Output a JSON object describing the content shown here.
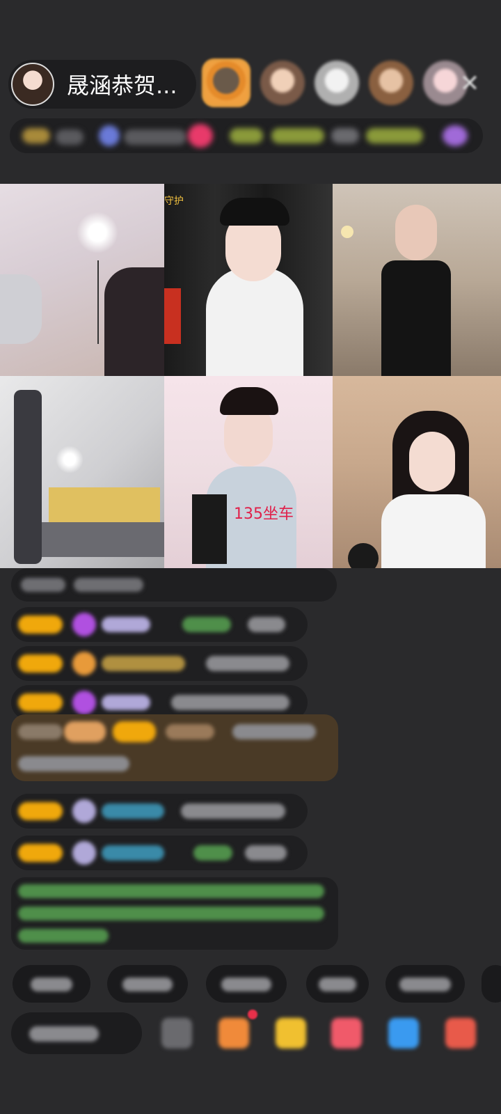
{
  "header": {
    "host_name": "晟涵恭贺...",
    "close_icon": "close-icon",
    "viewer_avatars": [
      "viewer-avatar-1",
      "viewer-avatar-2",
      "viewer-avatar-3",
      "viewer-avatar-4",
      "viewer-avatar-5"
    ]
  },
  "video_grid": {
    "tiles": [
      {
        "name": "streamer-tile-1"
      },
      {
        "name": "streamer-tile-2",
        "overlay_text": "守护"
      },
      {
        "name": "streamer-tile-3"
      },
      {
        "name": "streamer-tile-4"
      },
      {
        "name": "streamer-tile-5",
        "overlay_text": "135坐车"
      },
      {
        "name": "streamer-tile-6"
      }
    ]
  },
  "colors": {
    "background": "#2a2a2c",
    "badge_gold": "#f0a80c",
    "gift_row_bg": "#4a3a26",
    "system_text_green": "#4f8f4a"
  }
}
